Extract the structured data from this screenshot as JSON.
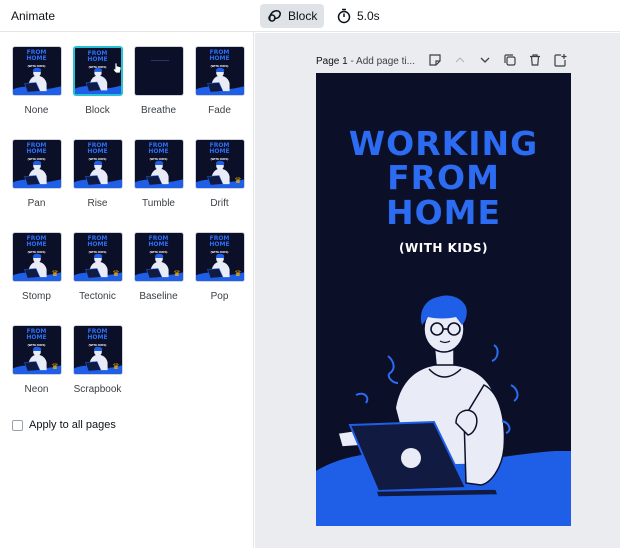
{
  "toolbar": {
    "panel_title": "Animate",
    "block_label": "Block",
    "duration_label": "5.0s"
  },
  "animations": [
    {
      "label": "None",
      "premium": false,
      "selected": false
    },
    {
      "label": "Block",
      "premium": false,
      "selected": true
    },
    {
      "label": "Breathe",
      "premium": false,
      "selected": false
    },
    {
      "label": "Fade",
      "premium": false,
      "selected": false
    },
    {
      "label": "Pan",
      "premium": false,
      "selected": false
    },
    {
      "label": "Rise",
      "premium": false,
      "selected": false
    },
    {
      "label": "Tumble",
      "premium": false,
      "selected": false
    },
    {
      "label": "Drift",
      "premium": true,
      "selected": false
    },
    {
      "label": "Stomp",
      "premium": true,
      "selected": false
    },
    {
      "label": "Tectonic",
      "premium": true,
      "selected": false
    },
    {
      "label": "Baseline",
      "premium": true,
      "selected": false
    },
    {
      "label": "Pop",
      "premium": true,
      "selected": false
    },
    {
      "label": "Neon",
      "premium": true,
      "selected": false
    },
    {
      "label": "Scrapbook",
      "premium": true,
      "selected": false
    }
  ],
  "thumb_text": {
    "line1": "FROM",
    "line2": "HOME",
    "line3": "(WITH KIDS)"
  },
  "apply_all": {
    "label": "Apply to all pages",
    "checked": false
  },
  "page": {
    "label": "Page 1",
    "title_placeholder": "Add page ti..."
  },
  "design": {
    "line1": "WORKING",
    "line2": "FROM",
    "line3": "HOME",
    "subtitle": "(WITH KIDS)",
    "background_color": "#0b0f28",
    "accent_color": "#2b6cf2"
  },
  "icons": {
    "block": "block-animation-icon",
    "timer": "stopwatch-icon",
    "notes": "notes-icon",
    "up": "chevron-up-icon",
    "down": "chevron-down-icon",
    "duplicate": "duplicate-page-icon",
    "delete": "trash-icon",
    "add": "add-page-icon",
    "premium": "crown-icon"
  }
}
